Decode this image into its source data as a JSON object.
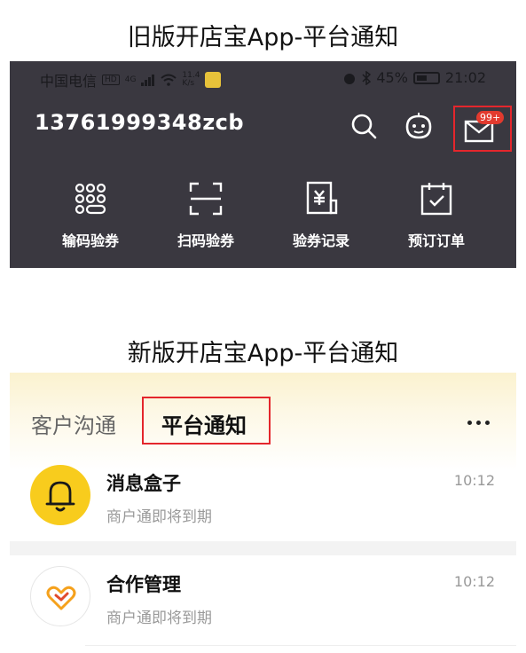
{
  "captions": {
    "old": "旧版开店宝App-平台通知",
    "new": "新版开店宝App-平台通知"
  },
  "old_app": {
    "status_bar": {
      "carrier": "中国电信",
      "hd": "HD",
      "signal": "4G",
      "speed_top": "11.4",
      "speed_unit": "K/s",
      "battery": "45%",
      "time": "21:02"
    },
    "account": "13761999348zcb",
    "header_icons": [
      "search-icon",
      "service-bot-icon",
      "mail-icon"
    ],
    "mail_badge": "99+",
    "quick_actions": [
      {
        "label": "输码验券",
        "icon": "keypad-icon"
      },
      {
        "label": "扫码验券",
        "icon": "scan-icon"
      },
      {
        "label": "验券记录",
        "icon": "voucher-record-icon"
      },
      {
        "label": "预订订单",
        "icon": "booking-order-icon"
      }
    ],
    "accent_color": "#e4262c",
    "background_color": "#3a3840"
  },
  "new_app": {
    "tabs": [
      {
        "label": "客户沟通",
        "active": false
      },
      {
        "label": "平台通知",
        "active": true
      }
    ],
    "more_icon": "more-icon",
    "notifications": [
      {
        "title": "消息盒子",
        "subtitle": "商户通即将到期",
        "time": "10:12",
        "icon": "bell-icon",
        "icon_bg": "#f8cc1d"
      },
      {
        "title": "合作管理",
        "subtitle": "商户通即将到期",
        "time": "10:12",
        "icon": "cooperation-icon",
        "icon_bg": "#ffffff"
      }
    ],
    "highlight_color": "#e4262c"
  }
}
